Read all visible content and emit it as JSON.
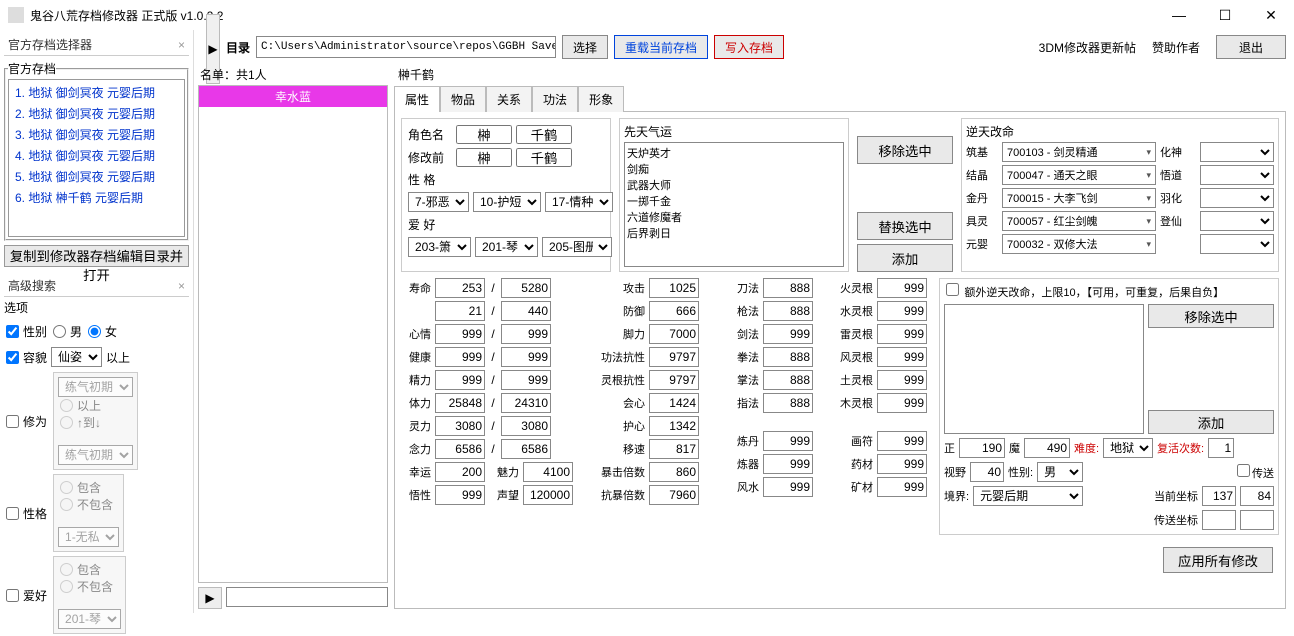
{
  "window": {
    "title": "鬼谷八荒存档修改器 正式版 v1.0.2.2",
    "min": "—",
    "max": "☐",
    "close": "✕"
  },
  "left": {
    "head": "官方存档选择器",
    "fieldset": "官方存档",
    "saves": [
      "1. 地狱  御剑冥夜  元婴后期",
      "2. 地狱  御剑冥夜  元婴后期",
      "3. 地狱  御剑冥夜  元婴后期",
      "4. 地狱  御剑冥夜  元婴后期",
      "5. 地狱  御剑冥夜  元婴后期",
      "6. 地狱  榊千鹤  元婴后期"
    ],
    "copybtn": "复制到修改器存档编辑目录并打开",
    "adv": {
      "head": "高级搜索",
      "opts": "选项",
      "gender": {
        "lbl": "性别",
        "m": "男",
        "f": "女"
      },
      "looks": {
        "lbl": "容貌",
        "sel": "仙姿",
        "suf": "以上"
      },
      "xiuwei": {
        "lbl": "修为",
        "sel1": "练气初期",
        "r1": "以上",
        "r2": "↑到↓",
        "sel2": "练气初期"
      },
      "xingge": {
        "lbl": "性格",
        "r1": "包含",
        "r2": "不包含",
        "sel": "1-无私"
      },
      "aihao": {
        "lbl": "爱好",
        "r1": "包含",
        "r2": "不包含",
        "sel": "201-琴"
      }
    }
  },
  "toolbar": {
    "dir": "目录",
    "path": "C:\\Users\\Administrator\\source\\repos\\GGBH SaveEd",
    "choose": "选择",
    "reload": "重载当前存档",
    "write": "写入存档",
    "update": "3DM修改器更新帖",
    "sponsor": "赞助作者",
    "exit": "退出"
  },
  "namecol": {
    "head": "名单：共1人",
    "item": "幸水蓝"
  },
  "char": {
    "name": "榊千鹤",
    "tabs": [
      "属性",
      "物品",
      "关系",
      "功法",
      "形象"
    ],
    "id": {
      "rolename": "角色名",
      "surname": "榊",
      "given": "千鹤",
      "before": "修改前",
      "bsur": "榊",
      "bgiv": "千鹤",
      "xingge": "性 格",
      "x1": "7-邪恶",
      "x2": "10-护短",
      "x3": "17-情种",
      "aihao": "爱 好",
      "a1": "203-箫",
      "a2": "201-琴",
      "a3": "205-图册"
    },
    "luck": {
      "hd": "先天气运",
      "items": [
        "天炉英才",
        "剑痴",
        "武器大师",
        "一掷千金",
        "六道修魔者",
        "后界剥日"
      ],
      "remove": "移除选中",
      "replace": "替换选中",
      "add": "添加"
    },
    "dest": {
      "hd": "逆天改命",
      "rows": [
        {
          "k": "筑基",
          "v": "700103 - 剑灵精通",
          "r": "化神"
        },
        {
          "k": "结晶",
          "v": "700047 - 通天之眼",
          "r": "悟道"
        },
        {
          "k": "金丹",
          "v": "700015 - 大李飞剑",
          "r": "羽化"
        },
        {
          "k": "具灵",
          "v": "700057 - 红尘剑魄",
          "r": "登仙"
        },
        {
          "k": "元婴",
          "v": "700032 - 双修大法",
          "r": ""
        }
      ]
    },
    "extra": {
      "chk": "额外逆天改命，上限10，【可用，可重复，后果自负】",
      "remove": "移除选中",
      "add": "添加"
    },
    "stats1": [
      {
        "l": "寿命",
        "a": "253",
        "b": "5280"
      },
      {
        "l": "",
        "a": "21",
        "b": "440"
      },
      {
        "l": "心情",
        "a": "999",
        "b": "999"
      },
      {
        "l": "健康",
        "a": "999",
        "b": "999"
      },
      {
        "l": "精力",
        "a": "999",
        "b": "999"
      },
      {
        "l": "体力",
        "a": "25848",
        "b": "24310"
      },
      {
        "l": "灵力",
        "a": "3080",
        "b": "3080"
      },
      {
        "l": "念力",
        "a": "6586",
        "b": "6586"
      },
      {
        "l": "幸运",
        "a": "200",
        "l2": "魅力",
        "b": "4100"
      },
      {
        "l": "悟性",
        "a": "999",
        "l2": "声望",
        "b": "120000"
      }
    ],
    "stats2": [
      {
        "l": "攻击",
        "v": "1025"
      },
      {
        "l": "防御",
        "v": "666"
      },
      {
        "l": "脚力",
        "v": "7000"
      },
      {
        "l": "功法抗性",
        "v": "9797"
      },
      {
        "l": "灵根抗性",
        "v": "9797"
      },
      {
        "l": "会心",
        "v": "1424"
      },
      {
        "l": "护心",
        "v": "1342"
      },
      {
        "l": "移速",
        "v": "817"
      },
      {
        "l": "暴击倍数",
        "v": "860"
      },
      {
        "l": "抗暴倍数",
        "v": "7960"
      }
    ],
    "stats3": [
      {
        "l": "刀法",
        "v": "888"
      },
      {
        "l": "枪法",
        "v": "888"
      },
      {
        "l": "剑法",
        "v": "999"
      },
      {
        "l": "拳法",
        "v": "888"
      },
      {
        "l": "掌法",
        "v": "888"
      },
      {
        "l": "指法",
        "v": "888"
      },
      {
        "l": "",
        "v": ""
      },
      {
        "l": "炼丹",
        "v": "999"
      },
      {
        "l": "炼器",
        "v": "999"
      },
      {
        "l": "风水",
        "v": "999"
      }
    ],
    "stats4": [
      {
        "l": "火灵根",
        "v": "999"
      },
      {
        "l": "水灵根",
        "v": "999"
      },
      {
        "l": "雷灵根",
        "v": "999"
      },
      {
        "l": "风灵根",
        "v": "999"
      },
      {
        "l": "土灵根",
        "v": "999"
      },
      {
        "l": "木灵根",
        "v": "999"
      },
      {
        "l": "",
        "v": ""
      },
      {
        "l": "画符",
        "v": "999"
      },
      {
        "l": "药材",
        "v": "999"
      },
      {
        "l": "矿材",
        "v": "999"
      }
    ],
    "misc": {
      "zheng": "正",
      "zhengv": "190",
      "mo": "魔",
      "mov": "490",
      "nandu": "难度:",
      "nanduv": "地狱",
      "fuhuo": "复活次数:",
      "fuhuov": "1",
      "shiye": "视野",
      "shiyev": "40",
      "xingbie": "性别:",
      "xingbiev": "男",
      "chuansong": "传送",
      "jingjie": "境界:",
      "jingjiev": "元婴后期",
      "dangqian": "当前坐标",
      "dq1": "137",
      "dq2": "84",
      "cs": "传送坐标"
    }
  },
  "footer": {
    "apply": "应用所有修改"
  }
}
